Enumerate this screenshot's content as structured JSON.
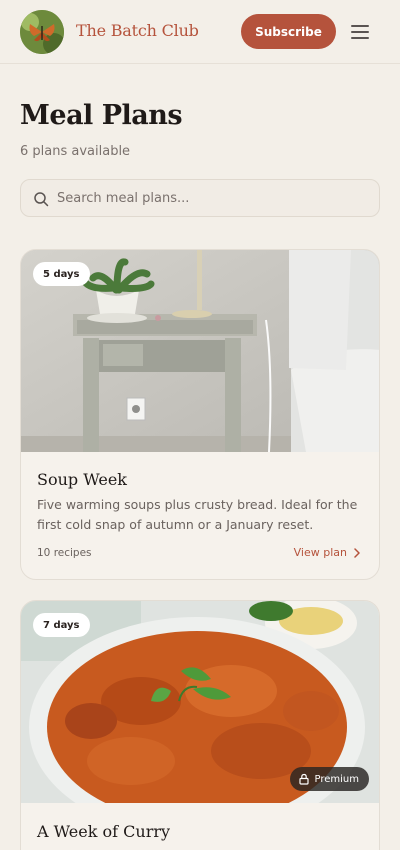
{
  "header": {
    "brand": "The Batch Club",
    "subscribe_label": "Subscribe",
    "menu_icon": "hamburger-icon",
    "avatar_icon": "butterfly-avatar"
  },
  "page": {
    "title": "Meal Plans",
    "count": "6 plans available"
  },
  "search": {
    "placeholder": "Search meal plans...",
    "value": "",
    "icon": "search-icon"
  },
  "plans": [
    {
      "badge": "5 days",
      "title": "Soup Week",
      "description": "Five warming soups plus crusty bread. Ideal for the first cold snap of autumn or a January reset.",
      "recipes": "10 recipes",
      "link": "View plan"
    },
    {
      "badge": "7 days",
      "title": "A Week of Curry",
      "premium": "Premium"
    }
  ],
  "colors": {
    "accent": "#b5533c",
    "background": "#f3efe8"
  }
}
